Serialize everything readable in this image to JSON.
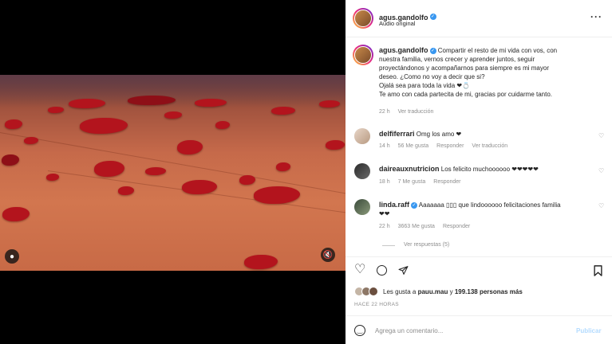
{
  "post": {
    "username": "agus.gandolfo",
    "audio": "Audio original",
    "more_icon": "more-icon",
    "caption_lines": [
      "Compartir el resto de mi vida con vos, con",
      "nuestra familia, vernos crecer y aprender juntos, seguir",
      "proyectándonos y acompañarnos para siempre es mi mayor",
      "deseo. ¿Como no voy a decir que si?",
      "Ojalá sea para toda la vida ❤💍",
      "Te amo con cada partecita de mi, gracias por cuidarme tanto."
    ],
    "caption_time": "22 h",
    "caption_translate": "Ver traducción"
  },
  "comments": [
    {
      "username": "delfiferrari",
      "text": "Omg los amo ❤",
      "time": "14 h",
      "likes": "56 Me gusta",
      "reply": "Responder",
      "translate": "Ver traducción"
    },
    {
      "username": "daireauxnutricion",
      "text": "Los felicito muchoooooo ❤❤❤❤❤",
      "time": "18 h",
      "likes": "7 Me gusta",
      "reply": "Responder"
    },
    {
      "username": "linda.raff",
      "text": "Aaaaaaa ▯▯▯ que lindoooooo felicitaciones familia",
      "text2": "❤❤",
      "time": "22 h",
      "likes": "3663 Me gusta",
      "reply": "Responder",
      "replies": "Ver respuestas (5)"
    }
  ],
  "actions": {
    "like_icon": "heart-icon",
    "comment_icon": "comment-icon",
    "share_icon": "send-icon",
    "save_icon": "bookmark-icon"
  },
  "likes": {
    "prefix": "Les gusta a ",
    "user": "pauu.mau",
    "middle": " y ",
    "count": "199.138 personas más"
  },
  "timestamp": "HACE 22 HORAS",
  "add_comment": {
    "placeholder": "Agrega un comentario...",
    "publish": "Publicar"
  },
  "colors": {
    "verified": "#3897f0",
    "publish": "#b3dbff",
    "heart": "#e0202e"
  }
}
